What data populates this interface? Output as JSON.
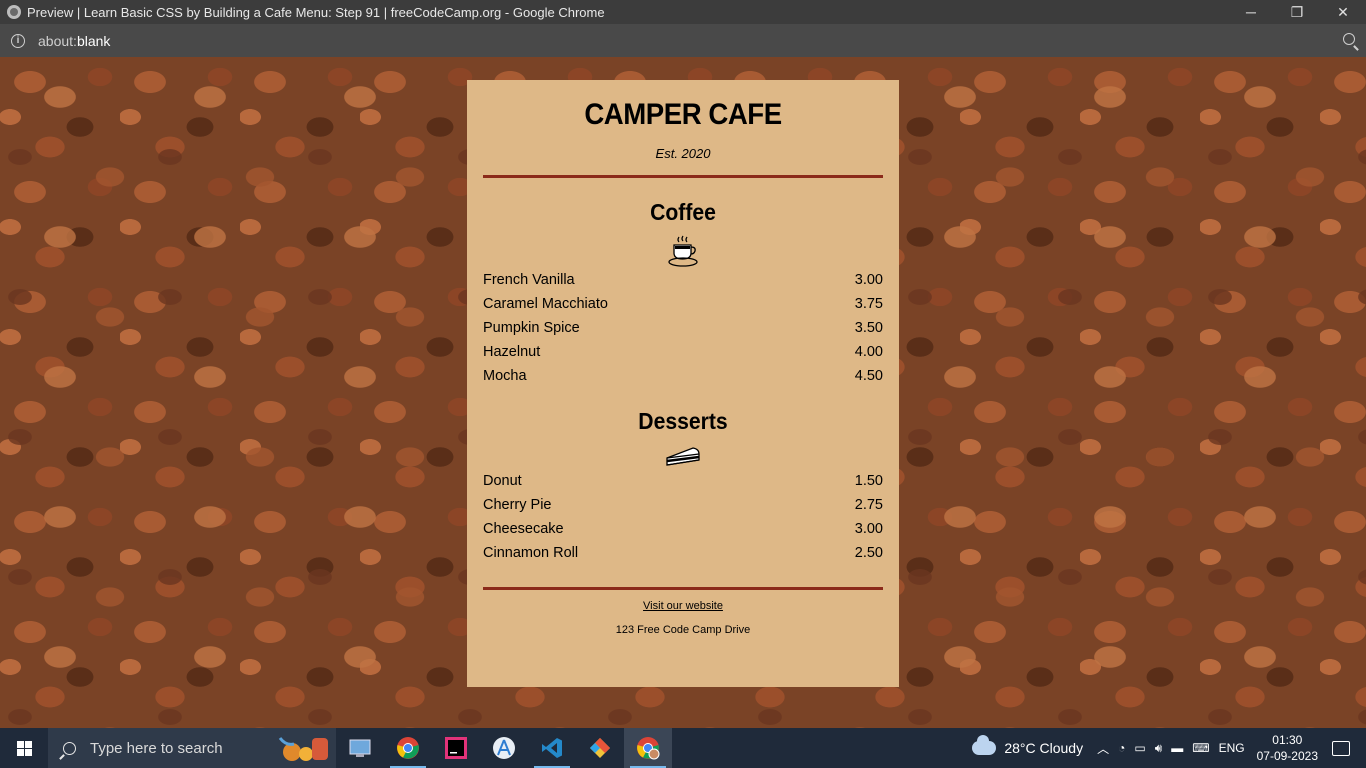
{
  "window": {
    "title": "Preview | Learn Basic CSS by Building a Cafe Menu: Step 91 | freeCodeCamp.org - Google Chrome",
    "minimize": "─",
    "restore": "❐",
    "close": "✕"
  },
  "address": {
    "prefix": "about:",
    "host": "blank"
  },
  "menu": {
    "title": "CAMPER CAFE",
    "established": "Est. 2020",
    "coffee": {
      "heading": "Coffee",
      "items": [
        {
          "name": "French Vanilla",
          "price": "3.00"
        },
        {
          "name": "Caramel Macchiato",
          "price": "3.75"
        },
        {
          "name": "Pumpkin Spice",
          "price": "3.50"
        },
        {
          "name": "Hazelnut",
          "price": "4.00"
        },
        {
          "name": "Mocha",
          "price": "4.50"
        }
      ]
    },
    "desserts": {
      "heading": "Desserts",
      "items": [
        {
          "name": "Donut",
          "price": "1.50"
        },
        {
          "name": "Cherry Pie",
          "price": "2.75"
        },
        {
          "name": "Cheesecake",
          "price": "3.00"
        },
        {
          "name": "Cinnamon Roll",
          "price": "2.50"
        }
      ]
    },
    "footer": {
      "link": "Visit our website",
      "address": "123 Free Code Camp Drive"
    }
  },
  "taskbar": {
    "search_placeholder": "Type here to search",
    "weather": "28°C  Cloudy",
    "language": "ENG",
    "time": "01:30",
    "date": "07-09-2023"
  }
}
